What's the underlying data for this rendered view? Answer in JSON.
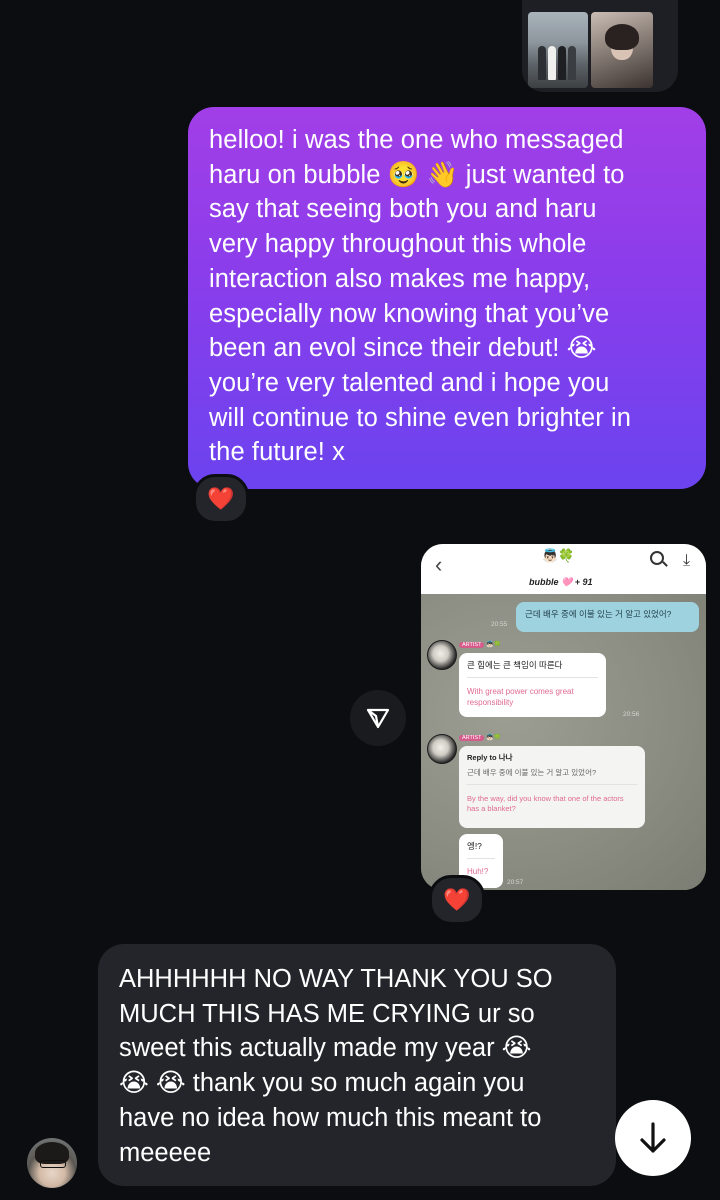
{
  "colors": {
    "background": "#0c0d10",
    "outgoing_bubble_top": "#a23ee7",
    "outgoing_bubble_bottom": "#6b43ef",
    "incoming_bubble": "#24252b",
    "reaction_heart": "#e2253b"
  },
  "top_photos": {
    "icon": "shared-photos"
  },
  "outgoing_message": {
    "text": "helloo! i was the one who messaged\nharu on bubble 🥹 👋 just wanted to\nsay that seeing both you and haru\nvery happy throughout this whole\ninteraction also makes me happy,\nespecially now knowing that you’ve\nbeen an evol since their debut! 😭\nyou’re very talented and i hope you\nwill continue to shine even brighter in\nthe future! x",
    "reaction": "❤️"
  },
  "shared_screenshot": {
    "header_emoji": "👼🏻🍀",
    "header_title": "bubble 🩷 + 91",
    "my_message": "근데 배우 중에 이불 있는 거 알고 있었어?",
    "my_time": "20:55",
    "artist_tag": "ARTIST",
    "artist_emoji": "👼🏻🍀",
    "reply1_ko": "큰 힘에는 큰 책임이 따른다",
    "reply1_en": "With great power comes great responsibility",
    "reply1_time": "20:56",
    "reply_to_label": "Reply to",
    "reply_to_name": "나나",
    "reply_quote_ko": "근데 배우 중에 이불 있는 거 알고 있었어?",
    "reply_quote_en": "By the way, did you know that one of the actors has a blanket?",
    "reply2_ko": "엥!?",
    "reply2_en": "Huh!?",
    "reply2_time": "20:57",
    "reaction": "❤️"
  },
  "share_button": {
    "icon": "send-icon"
  },
  "incoming_message": {
    "text": "AHHHHHH NO WAY THANK YOU SO\nMUCH THIS HAS ME CRYING ur so\nsweet this actually made my year 😭\n😭 😭  thank you so much again you\nhave no idea how much this meant to\nmeeeee"
  },
  "scroll_button": {
    "icon": "arrow-down-icon"
  }
}
